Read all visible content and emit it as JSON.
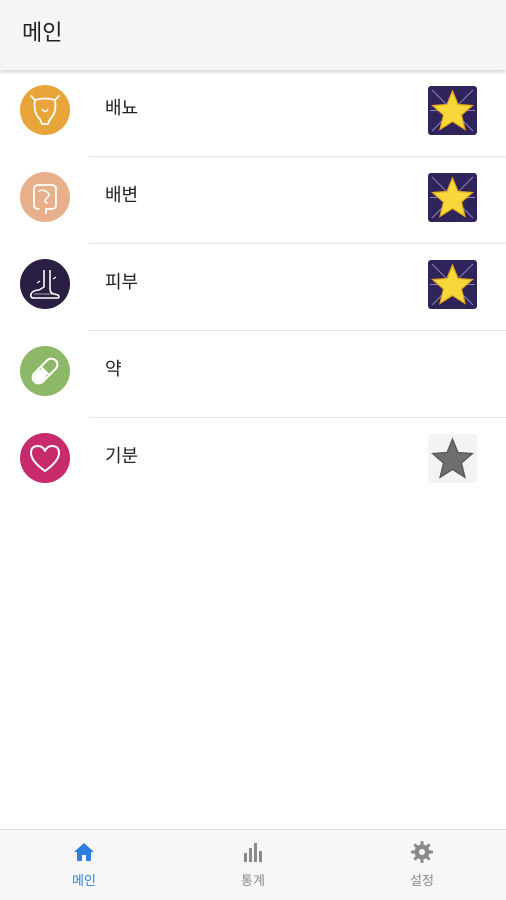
{
  "app_bar": {
    "title": "메인"
  },
  "items": [
    {
      "label": "배뇨",
      "icon": "bladder-icon",
      "icon_color": "#e8a53a",
      "star": "active"
    },
    {
      "label": "배변",
      "icon": "intestine-icon",
      "icon_color": "#e7b08a",
      "star": "active"
    },
    {
      "label": "피부",
      "icon": "foot-skin-icon",
      "icon_color": "#2a1e42",
      "star": "active"
    },
    {
      "label": "약",
      "icon": "pill-icon",
      "icon_color": "#8db868",
      "star": "none"
    },
    {
      "label": "기분",
      "icon": "heart-icon",
      "icon_color": "#c72b6c",
      "star": "inactive"
    }
  ],
  "nav": {
    "items": [
      {
        "label": "메인",
        "icon": "home-icon",
        "active": true
      },
      {
        "label": "통계",
        "icon": "bar-chart-icon",
        "active": false
      },
      {
        "label": "설정",
        "icon": "gear-icon",
        "active": false
      }
    ]
  },
  "colors": {
    "active": "#2f7de1",
    "inactive": "#8a8a8a",
    "star_active_bg": "#2f2459",
    "star_yellow": "#f7d83a"
  }
}
